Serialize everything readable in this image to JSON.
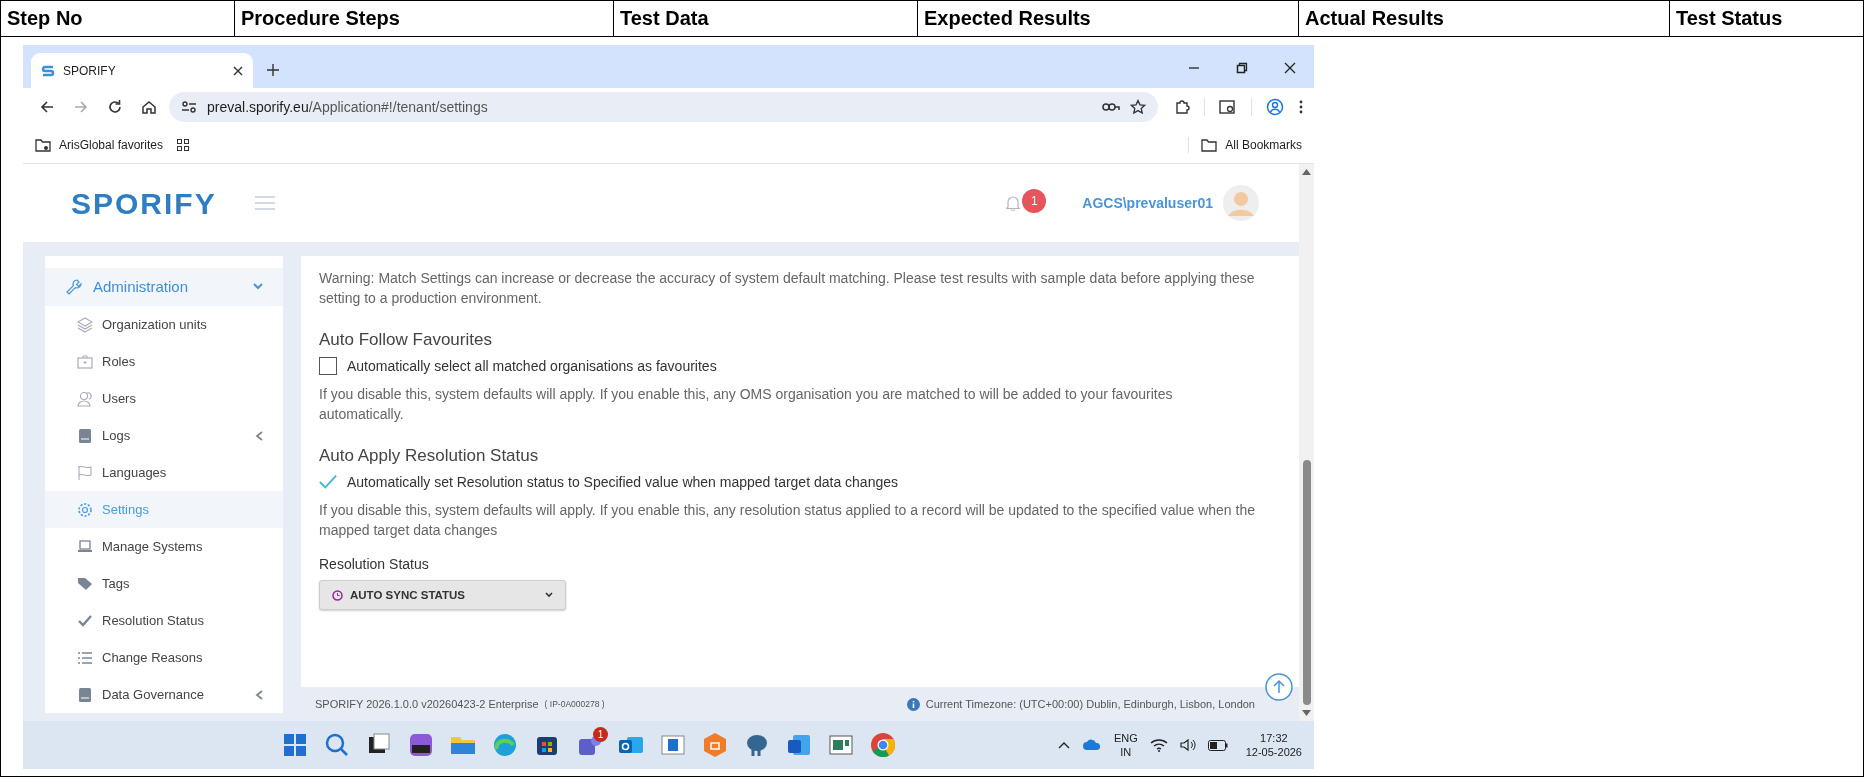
{
  "table": {
    "columns": [
      "Step No",
      "Procedure Steps",
      "Test Data",
      "Expected Results",
      "Actual Results",
      "Test Status"
    ]
  },
  "browser": {
    "tab_title": "SPORIFY",
    "url_host": "preval.sporify.eu",
    "url_path": "/Application#!/tenant/settings",
    "bookmark": "ArisGlobal favorites",
    "all_bookmarks": "All Bookmarks"
  },
  "app": {
    "logo": "SPORIFY",
    "notification_count": "1",
    "user": "AGCS\\prevaluser01",
    "sidebar": {
      "group": {
        "label": "Administration",
        "expanded": true
      },
      "items": [
        {
          "label": "Organization units",
          "selected": false,
          "has_submenu": false
        },
        {
          "label": "Roles",
          "selected": false,
          "has_submenu": false
        },
        {
          "label": "Users",
          "selected": false,
          "has_submenu": false
        },
        {
          "label": "Logs",
          "selected": false,
          "has_submenu": true
        },
        {
          "label": "Languages",
          "selected": false,
          "has_submenu": false
        },
        {
          "label": "Settings",
          "selected": true,
          "has_submenu": false
        },
        {
          "label": "Manage Systems",
          "selected": false,
          "has_submenu": false
        },
        {
          "label": "Tags",
          "selected": false,
          "has_submenu": false
        },
        {
          "label": "Resolution Status",
          "selected": false,
          "has_submenu": false
        },
        {
          "label": "Change Reasons",
          "selected": false,
          "has_submenu": false
        },
        {
          "label": "Data Governance",
          "selected": false,
          "has_submenu": true
        }
      ]
    },
    "warning": "Warning: Match Settings can increase or decrease the accuracy of system default matching. Please test results with sample data before applying these setting to a production environment.",
    "sections": [
      {
        "title": "Auto Follow Favourites",
        "checked": false,
        "label": "Automatically select all matched organisations as favourites",
        "help": "If you disable this, system defaults will apply. If you enable this, any OMS organisation you are matched to will be added to your favourites automatically."
      },
      {
        "title": "Auto Apply Resolution Status",
        "checked": true,
        "label": "Automatically set Resolution status to Specified value when mapped target data changes",
        "help": "If you disable this, system defaults will apply. If you enable this, any resolution status applied to a record will be updated to the specified value when the mapped target data changes"
      }
    ],
    "resolution_status": {
      "label": "Resolution Status",
      "value": "AUTO SYNC STATUS"
    },
    "footer": {
      "version": "SPORIFY 2026.1.0.0 v20260423-2 Enterprise",
      "build": "( IP-0A000278 )",
      "timezone": "Current Timezone: (UTC+00:00) Dublin, Edinburgh, Lisbon, London"
    }
  },
  "taskbar": {
    "teams_badge": "1",
    "language": "ENG",
    "region": "IN",
    "time": "17:32",
    "date": "12-05-2026"
  }
}
